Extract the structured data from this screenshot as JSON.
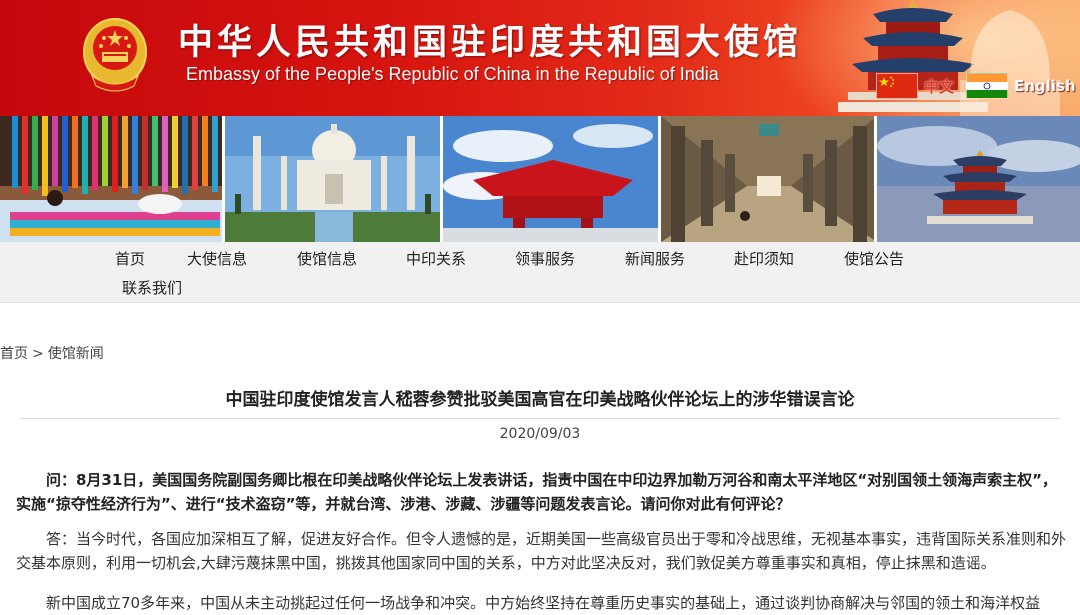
{
  "header": {
    "title_cn": "中华人民共和国驻印度共和国大使馆",
    "title_en": "Embassy of the People's Republic of China in the Republic of India",
    "emblem_icon": "national-emblem-icon",
    "languages": [
      {
        "label": "中文",
        "flag": "china-flag-icon"
      },
      {
        "label": "English",
        "flag": "india-flag-icon"
      }
    ]
  },
  "nav": {
    "items": [
      "首页",
      "大使信息",
      "使馆信息",
      "中印关系",
      "领事服务",
      "新闻服务",
      "赴印须知",
      "使馆公告",
      "联系我们"
    ]
  },
  "breadcrumb": {
    "home": "首页",
    "separator": ">",
    "section": "使馆新闻"
  },
  "article": {
    "title": "中国驻印度使馆发言人嵇蓉参赞批驳美国高官在印美战略伙伴论坛上的涉华错误言论",
    "date": "2020/09/03",
    "paragraphs": [
      "问：8月31日，美国国务院副国务卿比根在印美战略伙伴论坛上发表讲话，指责中国在中印边界加勒万河谷和南太平洋地区“对别国领土领海声索主权”，实施“掠夺性经济行为”、进行“技术盗窃”等，并就台湾、涉港、涉藏、涉疆等问题发表言论。请问你对此有何评论？",
      "答：当今时代，各国应加深相互了解，促进友好合作。但令人遗憾的是，近期美国一些高级官员出于零和冷战思维，无视基本事实，违背国际关系准则和外交基本原则，利用一切机会,大肆污蔑抹黑中国，挑拨其他国家同中国的关系，中方对此坚决反对，我们敦促美方尊重事实和真相，停止抹黑和造谣。",
      "新中国成立70多年来，中国从未主动挑起过任何一场战争和冲突。中方始终坚持在尊重历史事实的基础上，通过谈判协商解决与邻国的领土和海洋权益"
    ]
  },
  "colors": {
    "header_red": "#d6140f",
    "nav_bg": "#f1f1f1",
    "text": "#333333"
  }
}
